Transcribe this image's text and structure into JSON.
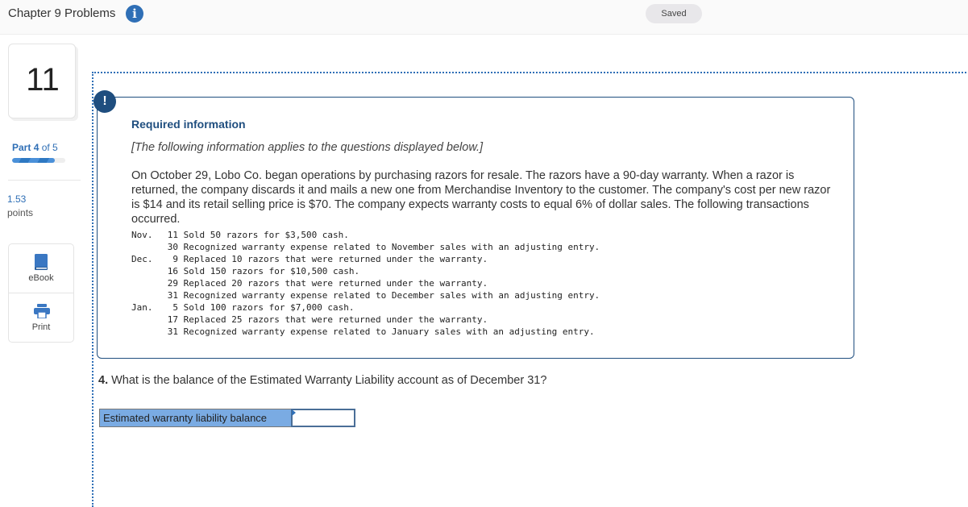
{
  "header": {
    "title": "Chapter 9 Problems",
    "info_icon": "info-icon",
    "status": "Saved"
  },
  "sidebar": {
    "question_number": "11",
    "part_prefix": "Part",
    "part_current": "4",
    "part_of": "of 5",
    "progress_fraction": 0.8,
    "points_value": "1.53",
    "points_label": "points",
    "tools": [
      {
        "label": "eBook",
        "icon": "book-icon"
      },
      {
        "label": "Print",
        "icon": "printer-icon"
      }
    ]
  },
  "required_info": {
    "alert_icon": "!",
    "title": "Required information",
    "subtitle": "[The following information applies to the questions displayed below.]",
    "body": "On October 29, Lobo Co. began operations by purchasing razors for resale. The razors have a 90-day warranty. When a razor is returned, the company discards it and mails a new one from Merchandise Inventory to the customer. The company's cost per new razor is $14 and its retail selling price is $70. The company expects warranty costs to equal 6%  of dollar sales. The following transactions occurred.",
    "transactions": [
      {
        "month": "Nov.",
        "day": "11",
        "text": "Sold 50 razors for $3,500 cash."
      },
      {
        "month": "",
        "day": "30",
        "text": "Recognized warranty expense related to November sales with an adjusting entry."
      },
      {
        "month": "Dec.",
        "day": "9",
        "text": "Replaced 10 razors that were returned under the warranty."
      },
      {
        "month": "",
        "day": "16",
        "text": "Sold 150 razors for $10,500 cash."
      },
      {
        "month": "",
        "day": "29",
        "text": "Replaced 20 razors that were returned under the warranty."
      },
      {
        "month": "",
        "day": "31",
        "text": "Recognized warranty expense related to December sales with an adjusting entry."
      },
      {
        "month": "Jan.",
        "day": "5",
        "text": "Sold 100 razors for $7,000 cash."
      },
      {
        "month": "",
        "day": "17",
        "text": "Replaced 25 razors that were returned under the warranty."
      },
      {
        "month": "",
        "day": "31",
        "text": "Recognized warranty expense related to January sales with an adjusting entry."
      }
    ]
  },
  "question": {
    "number": "4.",
    "text": " What is the balance of the Estimated Warranty Liability account as of December 31?",
    "answer_label": "Estimated warranty liability balance",
    "answer_value": ""
  }
}
